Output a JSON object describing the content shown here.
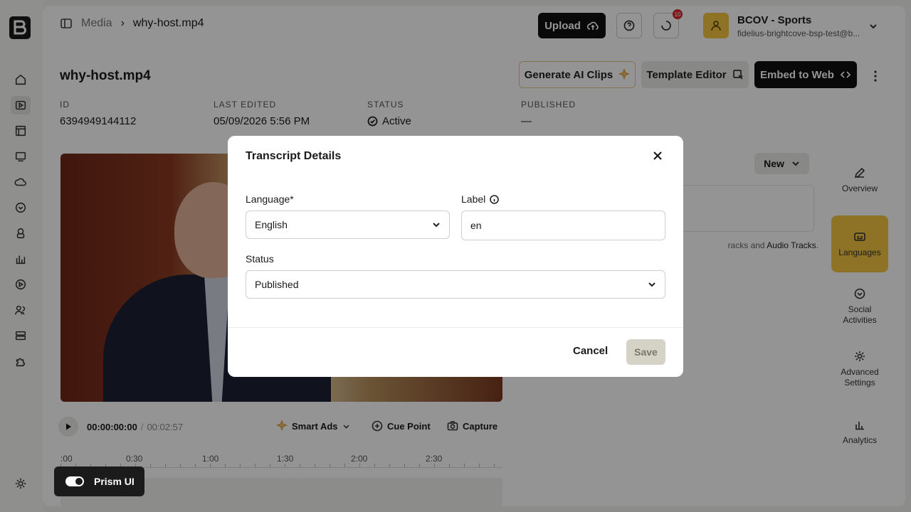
{
  "breadcrumb": {
    "section": "Media",
    "file": "why-host.mp4"
  },
  "header": {
    "upload_label": "Upload",
    "notification_count": "10",
    "account_name": "BCOV - Sports",
    "account_email": "fidelius-brightcove-bsp-test@b..."
  },
  "video": {
    "title": "why-host.mp4",
    "actions": {
      "ai_clips": "Generate AI Clips",
      "template": "Template Editor",
      "embed": "Embed to Web"
    },
    "meta": [
      {
        "label": "ID",
        "value": "6394949144112"
      },
      {
        "label": "LAST EDITED",
        "value": "05/09/2026 5:56 PM"
      },
      {
        "label": "STATUS",
        "value": "Active"
      },
      {
        "label": "PUBLISHED",
        "value": "—"
      }
    ]
  },
  "player": {
    "current": "00:00:00:00",
    "separator": "/",
    "duration": "00:02:57",
    "smart_ads": "Smart Ads",
    "cue_point": "Cue Point",
    "capture": "Capture",
    "ruler": [
      ":00",
      "0:30",
      "1:00",
      "1:30",
      "2:00",
      "2:30"
    ]
  },
  "languages_panel": {
    "new_label": "New",
    "note_pre": "racks",
    "note_mid": "and",
    "note_link": "Audio Tracks",
    "note_end": "."
  },
  "side_nav": [
    {
      "label": "Overview",
      "icon": "pencil-icon"
    },
    {
      "label": "Languages",
      "icon": "captions-icon"
    },
    {
      "label": "Social Activities",
      "icon": "social-icon"
    },
    {
      "label": "Advanced Settings",
      "icon": "gear-icon"
    },
    {
      "label": "Analytics",
      "icon": "bar-chart-icon"
    }
  ],
  "modal": {
    "title": "Transcript Details",
    "language_label": "Language*",
    "language_value": "English",
    "label_label": "Label",
    "label_value": "en",
    "status_label": "Status",
    "status_value": "Published",
    "cancel": "Cancel",
    "save": "Save"
  },
  "prism": {
    "label": "Prism UI"
  }
}
